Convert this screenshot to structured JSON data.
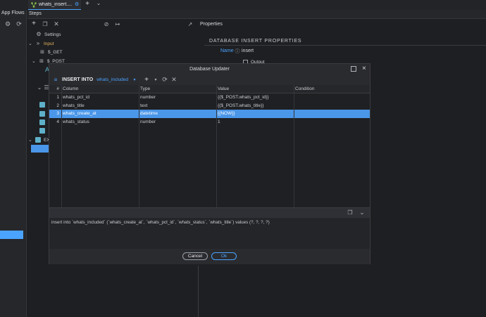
{
  "tabs": {
    "file_tab_label": "whats_insert....",
    "add_label": "+",
    "dropdown_label": "⌄"
  },
  "app_flows": {
    "title": "App Flows"
  },
  "steps": {
    "title": "Steps",
    "tree": [
      {
        "label": "Settings"
      },
      {
        "label": "Input"
      },
      {
        "label": "$_GET"
      },
      {
        "label": "$_POST"
      },
      {
        "label": "EX"
      }
    ]
  },
  "properties": {
    "title": "Properties",
    "section_title": "DATABASE INSERT PROPERTIES",
    "name_label": "Name",
    "name_value": "insert",
    "output_label": "Output"
  },
  "modal": {
    "title": "Database Updater",
    "insert_into_label": "INSERT INTO",
    "table_name": "whats_included",
    "columns_header": {
      "num": "#",
      "column": "Column",
      "type": "Type",
      "value": "Value",
      "condition": "Condition"
    },
    "rows": [
      {
        "num": "1",
        "column": "whats_pct_id",
        "type": "number",
        "value": "{{$_POST.whats_pct_id}}",
        "condition": ""
      },
      {
        "num": "2",
        "column": "whats_title",
        "type": "text",
        "value": "{{$_POST.whats_title}}",
        "condition": ""
      },
      {
        "num": "3",
        "column": "whats_create_at",
        "type": "datetime",
        "value": "{{NOW}}",
        "condition": ""
      },
      {
        "num": "4",
        "column": "whats_status",
        "type": "number",
        "value": "1",
        "condition": ""
      }
    ],
    "selected_row": 3,
    "sql": "insert into `whats_included` (`whats_create_at`, `whats_pct_id`, `whats_status`, `whats_title`) values (?, ?, ?, ?)",
    "cancel_label": "Cancel",
    "ok_label": "Ok"
  },
  "colors": {
    "accent": "#4aa3ff",
    "selection": "#4a96e8",
    "background": "#1e1f22"
  }
}
